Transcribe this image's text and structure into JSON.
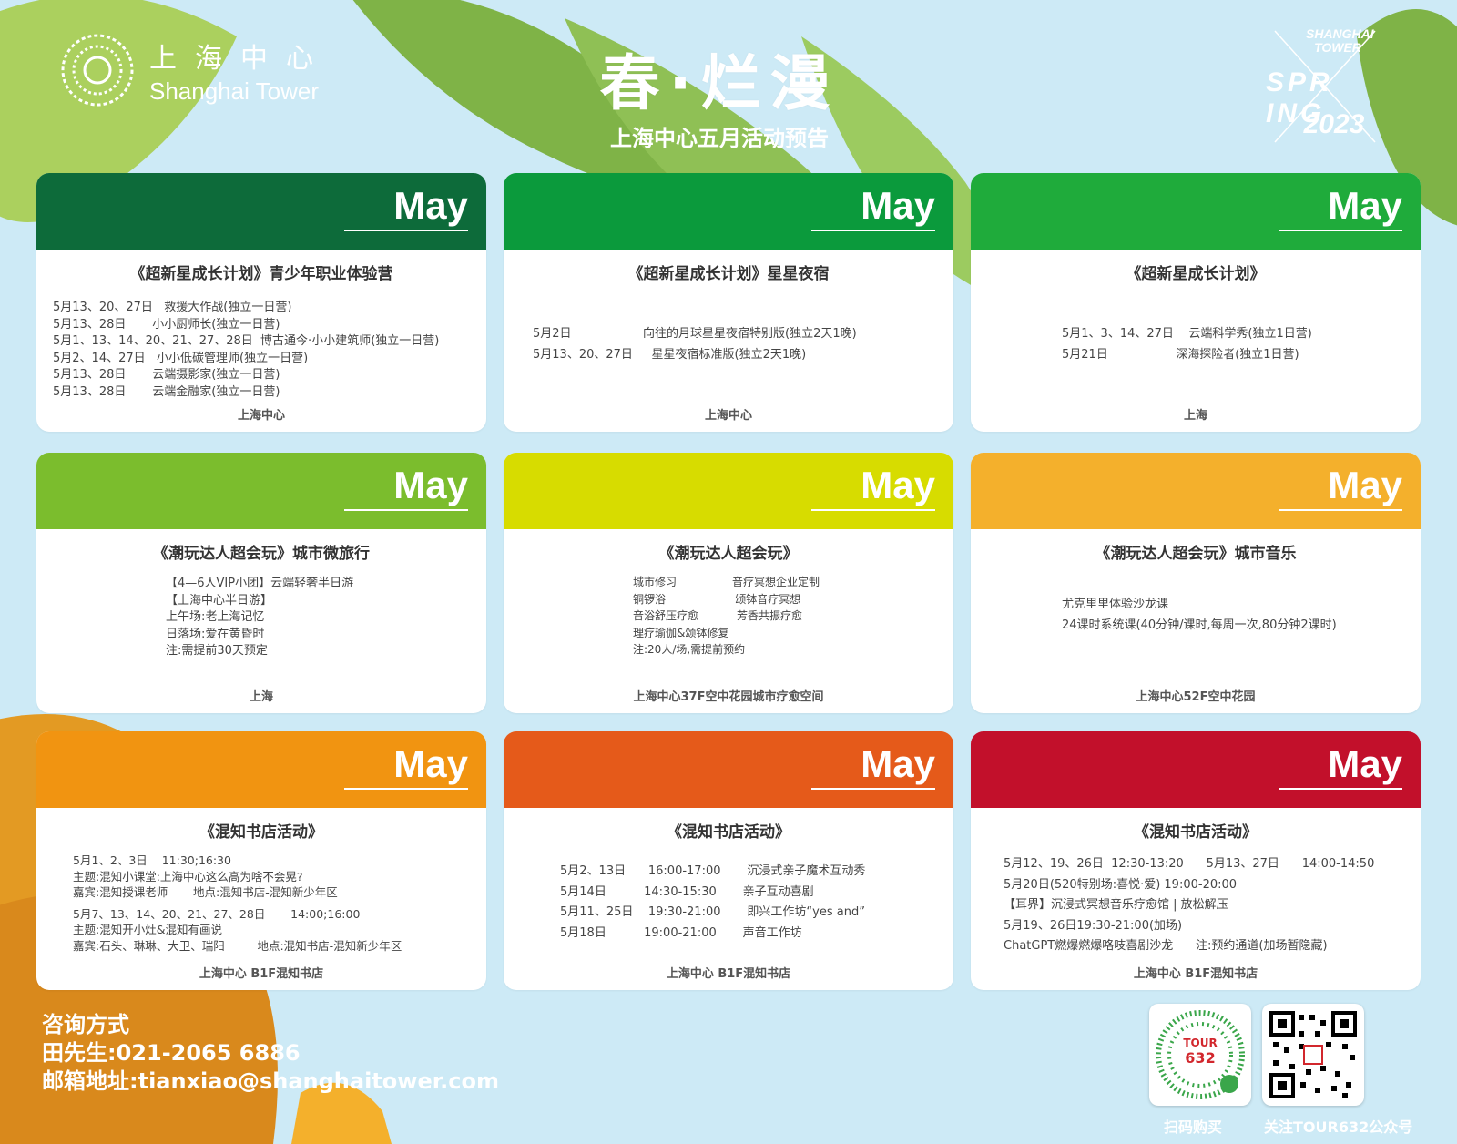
{
  "header": {
    "logo_cn": "上海中心",
    "logo_en": "Shanghai Tower",
    "title": "春·烂漫",
    "subtitle": "上海中心五月活动预告",
    "badge_top": "SHANGHAI TOWER",
    "badge_mid": "SPR ING",
    "badge_year": "2023"
  },
  "colors": {
    "c1": "#0d6b3a",
    "c2": "#0b9a3c",
    "c3": "#1fab3b",
    "c4": "#7bbd2d",
    "c5": "#d7dc00",
    "c6": "#f4b02c",
    "c7": "#f19411",
    "c8": "#e55a1a",
    "c9": "#c2102b"
  },
  "cards": [
    {
      "month": "May",
      "title": "《超新星成长计划》青少年职业体验营",
      "lines": [
        "5月13、20、27日   救援大作战(独立一日营)",
        "5月13、28日       小小厨师长(独立一日营)",
        "5月1、13、14、20、21、27、28日  博古通今·小小建筑师(独立一日营)",
        "5月2、14、27日   小小低碳管理师(独立一日营)",
        "5月13、28日       云端摄影家(独立一日营)",
        "5月13、28日       云端金融家(独立一日营)"
      ],
      "venue": "上海中心"
    },
    {
      "month": "May",
      "title": "《超新星成长计划》星星夜宿",
      "lines": [
        "5月2日                   向往的月球星星夜宿特别版(独立2天1晚)",
        "5月13、20、27日     星星夜宿标准版(独立2天1晚)"
      ],
      "venue": "上海中心"
    },
    {
      "month": "May",
      "title": "《超新星成长计划》",
      "lines": [
        "5月1、3、14、27日    云端科学秀(独立1日营)",
        "5月21日                  深海探险者(独立1日营)"
      ],
      "venue": "上海"
    },
    {
      "month": "May",
      "title": "《潮玩达人超会玩》城市微旅行",
      "lines": [
        "【4—6人VIP小团】云端轻奢半日游",
        "【上海中心半日游】",
        "上午场:老上海记忆",
        "日落场:爱在黄昏时",
        "注:需提前30天预定"
      ],
      "venue": "上海"
    },
    {
      "month": "May",
      "title": "《潮玩达人超会玩》",
      "lines": [
        "城市修习                音疗冥想企业定制",
        "铜锣浴                    颂钵音疗冥想",
        "音浴舒压疗愈           芳香共振疗愈",
        "理疗瑜伽&颂钵修复",
        "注:20人/场,需提前预约"
      ],
      "venue": "上海中心37F空中花园城市疗愈空间"
    },
    {
      "month": "May",
      "title": "《潮玩达人超会玩》城市音乐",
      "lines": [
        "尤克里里体验沙龙课",
        "24课时系统课(40分钟/课时,每周一次,80分钟2课时)"
      ],
      "venue": "上海中心52F空中花园"
    },
    {
      "month": "May",
      "title": "《混知书店活动》",
      "lines": [
        "5月1、2、3日    11:30;16:30",
        "主题:混知小课堂:上海中心这么高为啥不会晃?",
        "嘉宾:混知授课老师       地点:混知书店-混知新少年区",
        "",
        "5月7、13、14、20、21、27、28日       14:00;16:00",
        "主题:混知开小灶&混知有画说",
        "嘉宾:石头、琳琳、大卫、瑞阳         地点:混知书店-混知新少年区"
      ],
      "venue": "上海中心  B1F混知书店"
    },
    {
      "month": "May",
      "title": "《混知书店活动》",
      "lines": [
        "5月2、13日      16:00-17:00       沉浸式亲子魔术互动秀",
        "5月14日          14:30-15:30       亲子互动喜剧",
        "5月11、25日    19:30-21:00       即兴工作坊“yes and”",
        "5月18日          19:00-21:00       声音工作坊"
      ],
      "venue": "上海中心  B1F混知书店"
    },
    {
      "month": "May",
      "title": "《混知书店活动》",
      "lines": [
        "5月12、19、26日  12:30-13:20      5月13、27日      14:00-14:50",
        "5月20日(520特别场:喜悦·爱) 19:00-20:00",
        "【耳界】沉浸式冥想音乐疗愈馆 | 放松解压",
        "5月19、26日19:30-21:00(加场)",
        "ChatGPT燃爆燃爆咯吱喜剧沙龙      注:预约通道(加场暂隐藏)"
      ],
      "venue": "上海中心  B1F混知书店"
    }
  ],
  "contact": {
    "heading": "咨询方式",
    "phone": "田先生:021-2065 6886",
    "email": "邮箱地址:tianxiao@shanghaitower.com"
  },
  "qr": {
    "left_caption": "扫码购买",
    "right_caption": "关注TOUR632公众号",
    "mini_text_1": "TOUR",
    "mini_text_2": "632"
  }
}
